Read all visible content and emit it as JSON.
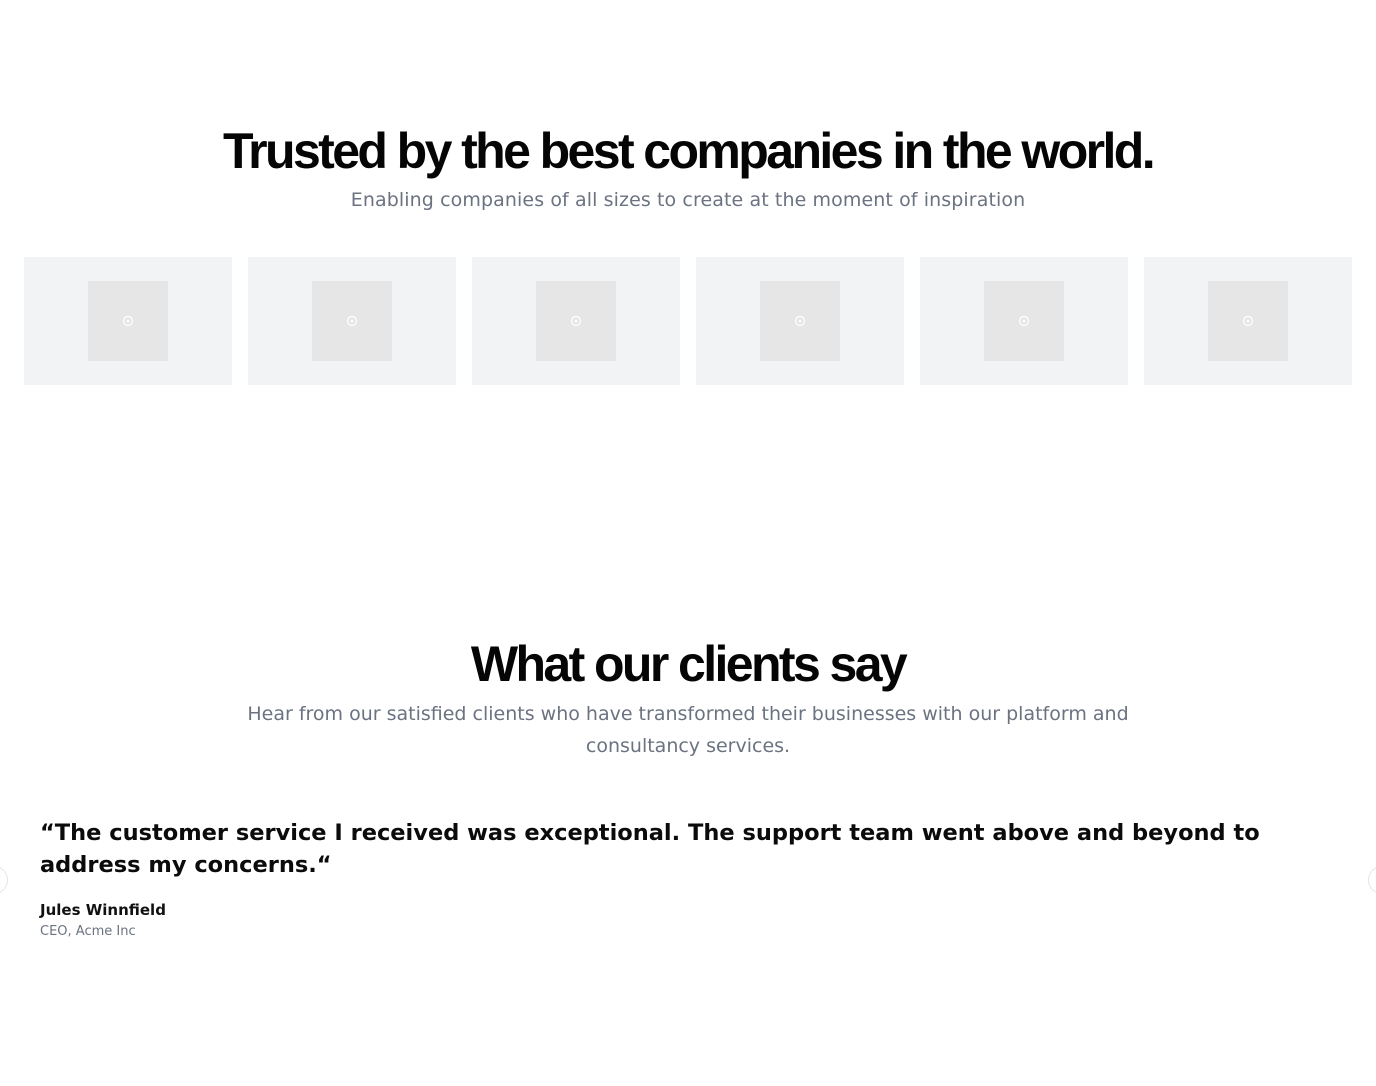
{
  "logos_section": {
    "title": "Trusted by the best companies in the world.",
    "subtitle": "Enabling companies of all sizes to create at the moment of inspiration",
    "logos": [
      {
        "icon": "image-placeholder-icon"
      },
      {
        "icon": "image-placeholder-icon"
      },
      {
        "icon": "image-placeholder-icon"
      },
      {
        "icon": "image-placeholder-icon"
      },
      {
        "icon": "image-placeholder-icon"
      },
      {
        "icon": "image-placeholder-icon"
      }
    ]
  },
  "testimonials_section": {
    "title": "What our clients say",
    "subtitle": "Hear from our satisfied clients who have transformed their businesses with our platform and consultancy services.",
    "quote": "“The customer service I received was exceptional. The support team went above and beyond to address my concerns.“",
    "author_name": "Jules Winnfield",
    "author_role": "CEO, Acme Inc",
    "prev_icon": "chevron-left-icon",
    "next_icon": "chevron-right-icon"
  },
  "colors": {
    "heading": "#050505",
    "muted_text": "#6b7280",
    "logo_card_bg": "#f1f3f5",
    "logo_placeholder_bg": "#e6e6e6"
  }
}
